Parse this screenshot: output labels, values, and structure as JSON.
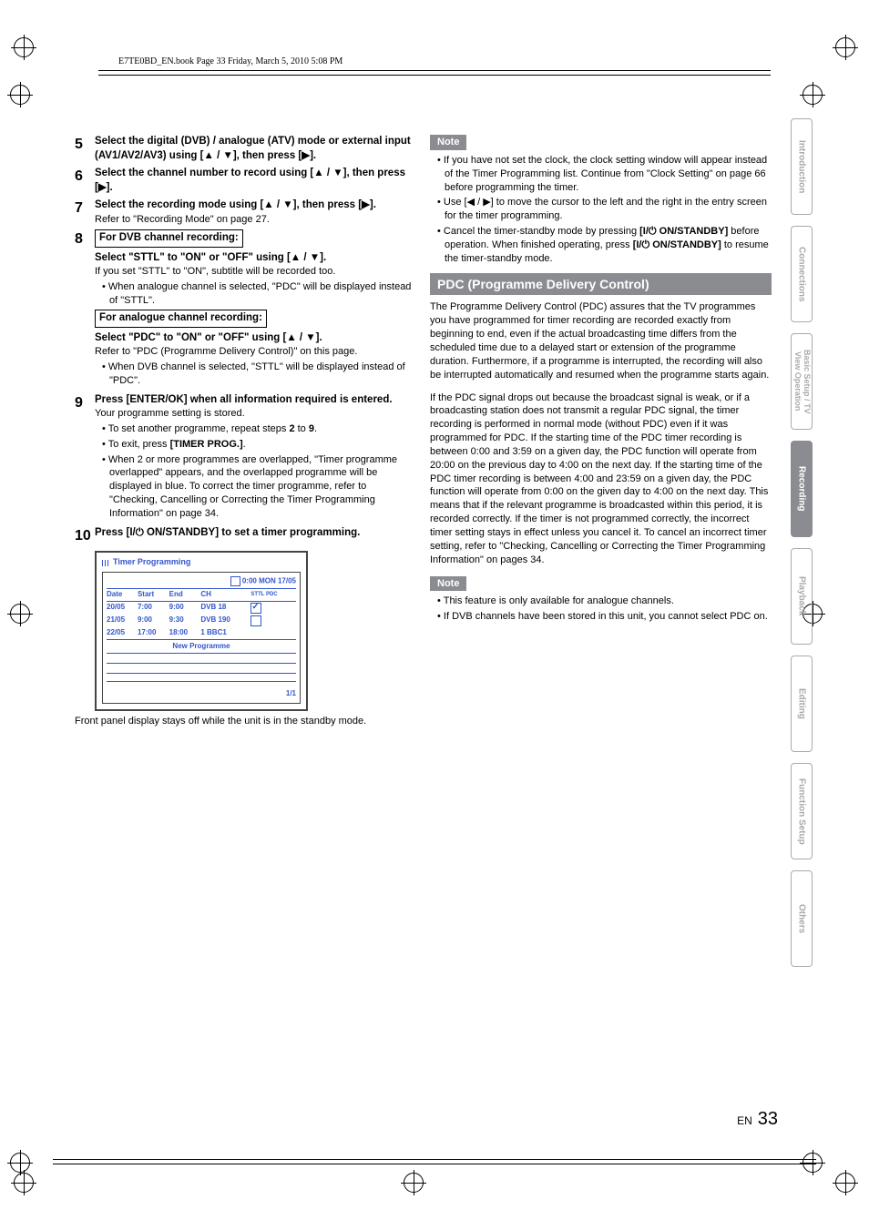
{
  "header": "E7TE0BD_EN.book  Page 33  Friday, March 5, 2010  5:08 PM",
  "left": {
    "s5": "Select the digital (DVB) / analogue (ATV) mode or external input (AV1/AV2/AV3) using [▲ / ▼], then press [▶].",
    "s6": "Select the channel number to record using [▲ / ▼], then press [▶].",
    "s7": "Select the recording mode using [▲ / ▼], then press [▶].",
    "s7_sub": "Refer to \"Recording Mode\" on page 27.",
    "s8_box1": "For DVB channel recording:",
    "s8_t1": "Select \"STTL\" to \"ON\" or \"OFF\" using [▲ / ▼].",
    "s8_b1": "If you set \"STTL\" to \"ON\", subtitle will be recorded too.",
    "s8_b2": "When analogue channel is selected, \"PDC\" will be displayed instead of \"STTL\".",
    "s8_box2": "For analogue channel recording:",
    "s8_t2": "Select \"PDC\" to \"ON\" or \"OFF\" using [▲ / ▼].",
    "s8_b3": "Refer to \"PDC (Programme Delivery Control)\" on this page.",
    "s8_b4": "When DVB channel is selected, \"STTL\" will be displayed instead of \"PDC\".",
    "s9": "Press [ENTER/OK] when all information required is entered.",
    "s9_sub": "Your programme setting is stored.",
    "s9_b1a": "To set another programme, repeat steps ",
    "s9_b1b": " to ",
    "s9_b1c": ".",
    "s9_n1": "2",
    "s9_n2": "9",
    "s9_b2": "To exit, press [TIMER PROG.].",
    "s9_b3": "When 2 or more programmes are overlapped, \"Timer programme overlapped\" appears, and the overlapped programme will be displayed in blue. To correct the timer programme, refer to \"Checking, Cancelling or Correcting the Timer Programming Information\" on page 34.",
    "s10": "Press [I/⏻ ON/STANDBY] to set a timer programming.",
    "timer_title": "Timer Programming",
    "timer_clock": "0:00 MON 17/05",
    "timer_headers": [
      "Date",
      "Start",
      "End",
      "CH",
      "STTL PDC"
    ],
    "timer_rows": [
      [
        "20/05",
        "7:00",
        "9:00",
        "DVB 18",
        "checked"
      ],
      [
        "21/05",
        "9:00",
        "9:30",
        "DVB 190",
        ""
      ],
      [
        "22/05",
        "17:00",
        "18:00",
        "1 BBC1",
        ""
      ]
    ],
    "timer_newprog": "New Programme",
    "timer_page": "1/1",
    "panel_note": "Front panel display stays off while the unit is in the standby mode."
  },
  "right": {
    "note1": "Note",
    "n1_b1": "If you have not set the clock, the clock setting window will appear instead of the Timer Programming list. Continue from \"Clock Setting\" on page 66 before programming the timer.",
    "n1_b2": "Use [◀ / ▶] to move the cursor to the left and the right in the entry screen for the timer programming.",
    "n1_b3a": "Cancel the timer-standby mode by pressing ",
    "n1_b3b": "[I/⏻ ON/STANDBY]",
    "n1_b3c": " before operation. When finished operating, press ",
    "n1_b3d": "[I/⏻ ON/STANDBY]",
    "n1_b3e": " to resume the timer-standby mode.",
    "section": "PDC (Programme Delivery Control)",
    "p1": "The Programme Delivery Control (PDC) assures that the TV programmes you have programmed for timer recording are recorded exactly from beginning to end, even if the actual broadcasting time differs from the scheduled time due to a delayed start or extension of the programme duration. Furthermore, if a programme is interrupted, the recording will also be interrupted automatically and resumed when the programme starts again.",
    "p2": "If the PDC signal drops out because the broadcast signal is weak, or if a broadcasting station does not transmit a regular PDC signal, the timer recording is performed in normal mode (without PDC) even if it was programmed for PDC. If the starting time of the PDC timer recording is between 0:00 and 3:59 on a given day, the PDC function will operate from 20:00 on the previous day to 4:00 on the next day. If the starting time of the PDC timer recording is between 4:00 and 23:59 on a given day, the PDC function will operate from 0:00 on the given day to 4:00 on the next day. This means that if the relevant programme is broadcasted within this period, it is recorded correctly. If the timer is not programmed correctly, the incorrect timer setting stays in effect unless you cancel it. To cancel an incorrect timer setting, refer to \"Checking, Cancelling or Correcting the Timer Programming Information\" on pages 34.",
    "note2": "Note",
    "n2_b1": "This feature is only available for analogue channels.",
    "n2_b2": "If DVB channels have been stored in this unit, you cannot select PDC on."
  },
  "tabs": [
    "Introduction",
    "Connections",
    "Basic Setup / TV View Operation",
    "Recording",
    "Playback",
    "Editing",
    "Function Setup",
    "Others"
  ],
  "active_tab": 3,
  "footer_lang": "EN",
  "footer_page": "33"
}
